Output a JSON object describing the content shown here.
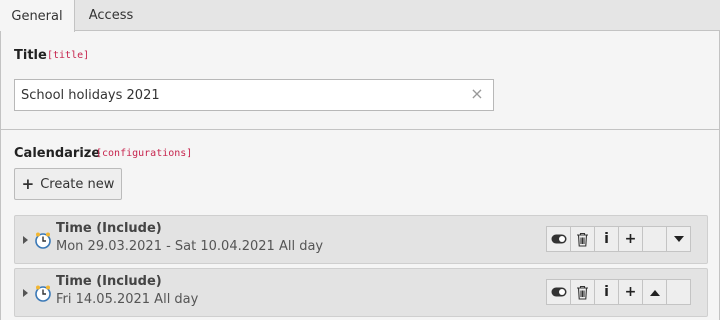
{
  "tabs": [
    {
      "label": "General",
      "active": true
    },
    {
      "label": "Access",
      "active": false
    }
  ],
  "title_field": {
    "label": "Title",
    "code": "[title]",
    "value": "School holidays 2021",
    "clear_icon": "close-icon"
  },
  "calendarize_field": {
    "label": "Calendarize",
    "code": "[configurations]",
    "create_button": "Create new",
    "records": [
      {
        "title": "Time (Include)",
        "subtitle": "Mon 29.03.2021 - Sat 10.04.2021 All day",
        "icon": "clock-icon",
        "controls": [
          "toggle-icon",
          "trash-icon",
          "info-icon",
          "plus-icon",
          "empty",
          "arrow-down-icon"
        ]
      },
      {
        "title": "Time (Include)",
        "subtitle": "Fri 14.05.2021 All day",
        "icon": "clock-icon",
        "controls": [
          "toggle-icon",
          "trash-icon",
          "info-icon",
          "plus-icon",
          "arrow-up-icon",
          "empty"
        ]
      }
    ]
  },
  "colors": {
    "code_text": "#c7254e",
    "tab_bar": "#e5e5e5",
    "background": "#f5f5f5",
    "record_bg": "#e3e3e3"
  }
}
